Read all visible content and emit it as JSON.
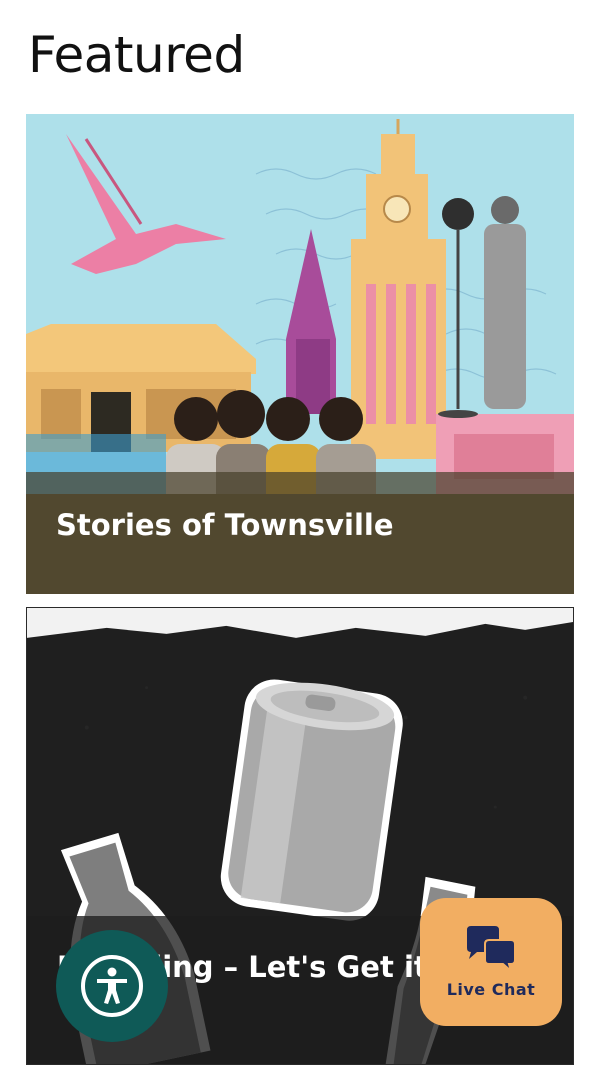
{
  "section": {
    "heading": "Featured"
  },
  "cards": [
    {
      "title": "Stories of Townsville",
      "image_subject": "collage-townsville-history"
    },
    {
      "title": "Recycling – Let's Get it Sorted",
      "image_subject": "recycling-can-bottles"
    }
  ],
  "accessibility": {
    "icon": "accessibility-icon"
  },
  "live_chat": {
    "label": "Live Chat",
    "icon": "chat-bubbles-icon"
  },
  "colors": {
    "accessibility_bg": "#0f5a57",
    "chat_bg": "#f2ae62",
    "chat_text": "#1f2a5c",
    "card1_sky": "#aee0ea"
  }
}
